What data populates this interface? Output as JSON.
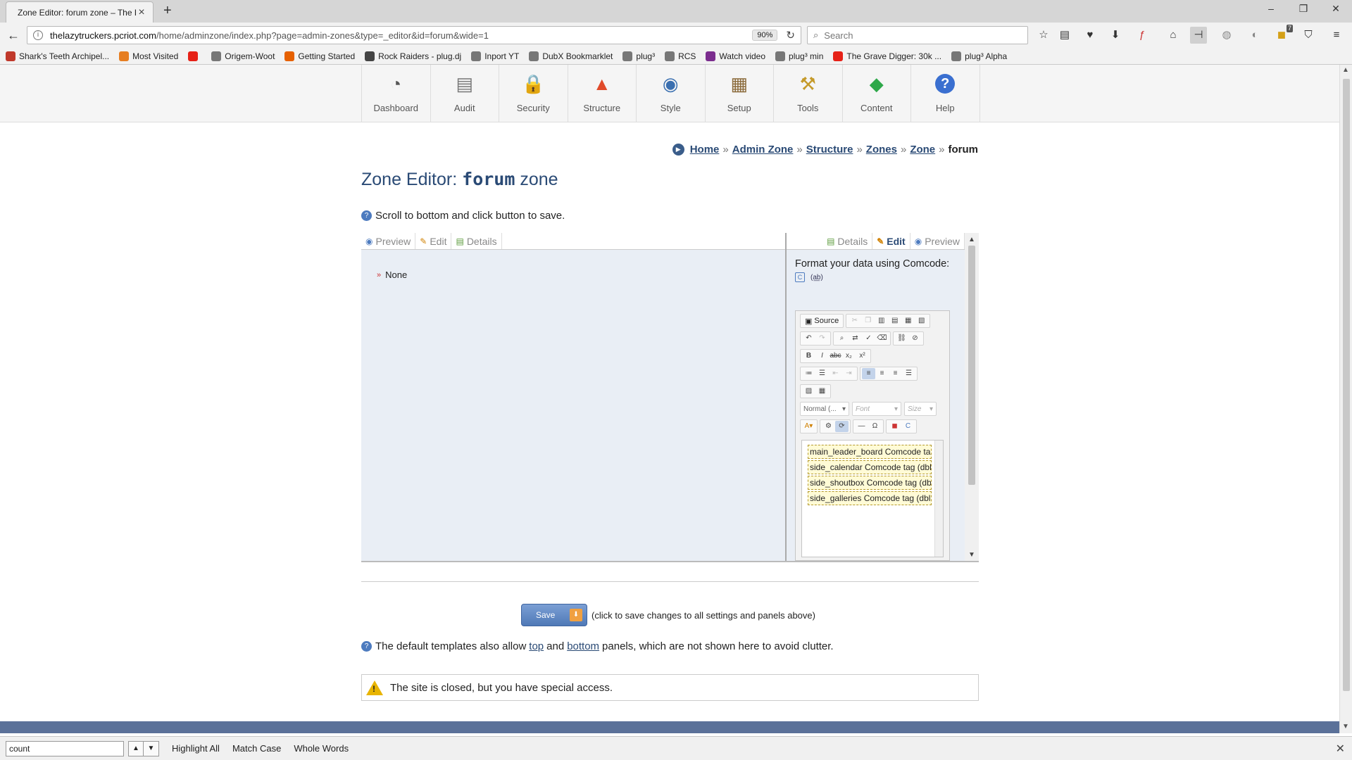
{
  "browser": {
    "tab_title": "Zone Editor: forum zone – The L",
    "url_host": "thelazytruckers.pcriot.com",
    "url_path": "/home/adminzone/index.php?page=admin-zones&type=_editor&id=forum&wide=1",
    "zoom": "90%",
    "search_placeholder": "Search",
    "badge_count": "7",
    "bookmarks": [
      {
        "label": "Shark's Teeth Archipel...",
        "color": "#c0392b"
      },
      {
        "label": "Most Visited",
        "color": "#e67e22"
      },
      {
        "label": "",
        "color": "#e62117"
      },
      {
        "label": "Origem-Woot",
        "color": "#777777"
      },
      {
        "label": "Getting Started",
        "color": "#e66000"
      },
      {
        "label": "Rock Raiders - plug.dj",
        "color": "#444444"
      },
      {
        "label": "Inport YT",
        "color": "#777777"
      },
      {
        "label": "DubX Bookmarklet",
        "color": "#777777"
      },
      {
        "label": "plug³",
        "color": "#777777"
      },
      {
        "label": "RCS",
        "color": "#777777"
      },
      {
        "label": "Watch video",
        "color": "#7b2d8e"
      },
      {
        "label": "plug³ min",
        "color": "#777777"
      },
      {
        "label": "The Grave Digger: 30k ...",
        "color": "#e62117"
      },
      {
        "label": "plug³ Alpha",
        "color": "#777777"
      }
    ]
  },
  "admin_nav": [
    {
      "label": "Dashboard",
      "icon": "gauge-icon",
      "glyph": "◔",
      "color": "#555555"
    },
    {
      "label": "Audit",
      "icon": "stack-icon",
      "glyph": "▤",
      "color": "#777777"
    },
    {
      "label": "Security",
      "icon": "padlock-icon",
      "glyph": "🔒",
      "color": "#d4a017"
    },
    {
      "label": "Structure",
      "icon": "pyramid-icon",
      "glyph": "▲",
      "color": "#e04a2a"
    },
    {
      "label": "Style",
      "icon": "glasses-icon",
      "glyph": "◉",
      "color": "#3a6fb0"
    },
    {
      "label": "Setup",
      "icon": "clipboard-icon",
      "glyph": "▦",
      "color": "#8b6a3a"
    },
    {
      "label": "Tools",
      "icon": "hammer-icon",
      "glyph": "⚒",
      "color": "#c59a2a"
    },
    {
      "label": "Content",
      "icon": "shapes-icon",
      "glyph": "◆",
      "color": "#2ea84a"
    },
    {
      "label": "Help",
      "icon": "question-icon",
      "glyph": "?",
      "color": "#3a6fd0"
    }
  ],
  "breadcrumb": {
    "items": [
      "Home",
      "Admin Zone",
      "Structure",
      "Zones",
      "Zone"
    ],
    "separator": "»",
    "current": "forum"
  },
  "page": {
    "title_prefix": "Zone Editor: ",
    "title_zone": "forum",
    "title_suffix": " zone",
    "help_text": "Scroll to bottom and click button to save."
  },
  "left_panel": {
    "tabs": [
      {
        "label": "Preview",
        "icon": "eye-icon",
        "active": false
      },
      {
        "label": "Edit",
        "icon": "pencil-icon",
        "active": false
      },
      {
        "label": "Details",
        "icon": "document-icon",
        "active": false
      }
    ],
    "items": [
      "None"
    ]
  },
  "right_panel": {
    "tabs": [
      {
        "label": "Details",
        "icon": "document-icon",
        "active": false
      },
      {
        "label": "Edit",
        "icon": "pencil-icon",
        "active": true
      },
      {
        "label": "Preview",
        "icon": "eye-icon",
        "active": false
      }
    ],
    "format_label": "Format your data using Comcode:",
    "editor": {
      "source_label": "Source",
      "format_combo": "Normal (...",
      "font_combo": "Font",
      "size_combo": "Size",
      "content_tags": [
        "main_leader_board Comcode tag (dbl-click to edit)",
        "side_calendar Comcode tag (dbl-click to edit)",
        "side_shoutbox Comcode tag (dbl-click to edit)",
        "side_galleries Comcode tag (dbl-click to edit)"
      ]
    }
  },
  "save": {
    "button_label": "Save",
    "note": "(click to save changes to all settings and panels above)"
  },
  "templates_note": {
    "before": "The default templates also allow",
    "top_link": "top",
    "and": "and",
    "bottom_link": "bottom",
    "after": "panels, which are not shown here to avoid clutter."
  },
  "warning": {
    "text": "The site is closed, but you have special access."
  },
  "findbar": {
    "query": "count",
    "options": [
      "Highlight All",
      "Match Case",
      "Whole Words"
    ]
  },
  "colors": {
    "accent": "#2a4a75",
    "save_button": "#5f86c3",
    "footer": "#5b7199",
    "tag_background": "#fffbd6"
  }
}
